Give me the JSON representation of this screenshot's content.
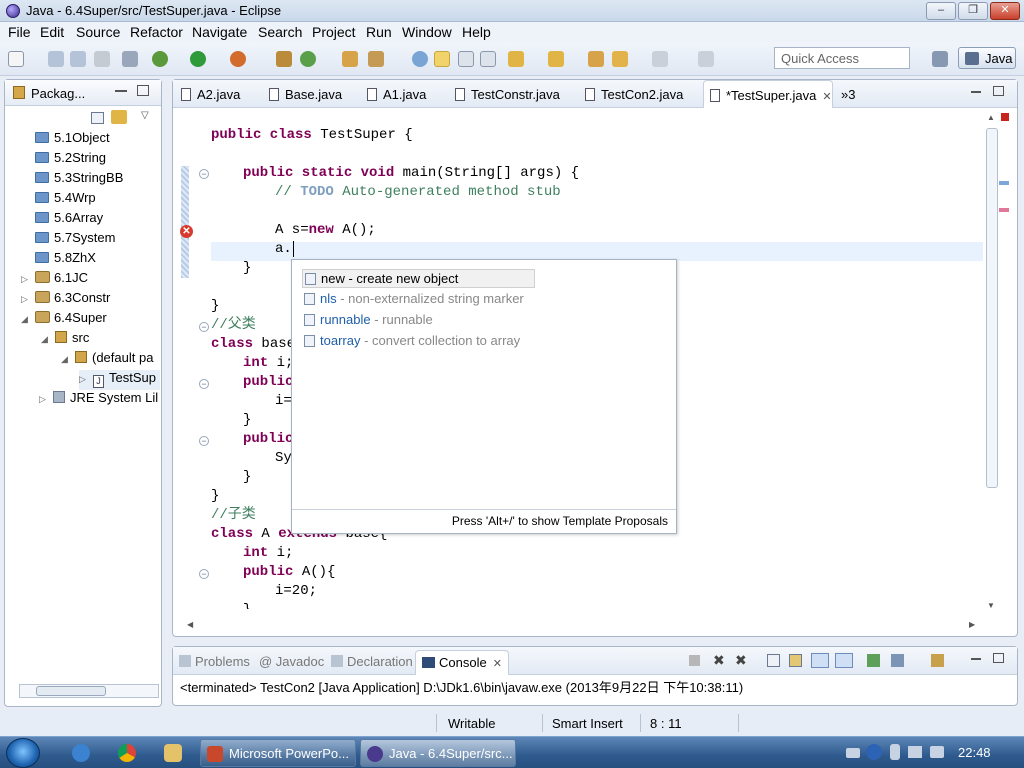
{
  "window": {
    "title": "Java - 6.4Super/src/TestSuper.java - Eclipse",
    "minimize": "–",
    "maximize": "❐",
    "close": "✕"
  },
  "menu": [
    "File",
    "Edit",
    "Source",
    "Refactor",
    "Navigate",
    "Search",
    "Project",
    "Run",
    "Window",
    "Help"
  ],
  "quick_access": {
    "placeholder": "Quick Access"
  },
  "perspective": {
    "label": "Java"
  },
  "package_explorer": {
    "title": "Packag...",
    "items": [
      {
        "label": "5.1Object",
        "kind": "folder"
      },
      {
        "label": "5.2String",
        "kind": "folder"
      },
      {
        "label": "5.3StringBB",
        "kind": "folder"
      },
      {
        "label": "5.4Wrp",
        "kind": "folder"
      },
      {
        "label": "5.6Array",
        "kind": "folder"
      },
      {
        "label": "5.7System",
        "kind": "folder"
      },
      {
        "label": "5.8ZhX",
        "kind": "folder"
      },
      {
        "label": "6.1JC",
        "kind": "project"
      },
      {
        "label": "6.3Constr",
        "kind": "project"
      },
      {
        "label": "6.4Super",
        "kind": "project"
      },
      {
        "label": "src",
        "kind": "srcfolder"
      },
      {
        "label": "(default pa",
        "kind": "package"
      },
      {
        "label": "TestSup",
        "kind": "javafile"
      },
      {
        "label": "JRE System Lil",
        "kind": "library"
      }
    ]
  },
  "editor": {
    "tabs": [
      "A2.java",
      "Base.java",
      "A1.java",
      "TestConstr.java",
      "TestCon2.java",
      "*TestSuper.java"
    ],
    "overflow_label": "»3",
    "tab_close": "✕",
    "code": {
      "l0": {
        "kw": "public class",
        "rest": " TestSuper {"
      },
      "l2": {
        "kw": "public static void",
        "rest": " main(String[] args) {"
      },
      "l3": {
        "pre": "// ",
        "todo": "TODO",
        "post": " Auto-generated method stub"
      },
      "l5": {
        "a": "A s=",
        "kw": "new",
        "b": " A();"
      },
      "l6": "a.",
      "l7": "}",
      "l9": "}",
      "l10": "//父类",
      "l11": {
        "kw": "class",
        "rest": " base"
      },
      "l12": {
        "kw": "int",
        "rest": " i;"
      },
      "l13": {
        "kw": "public"
      },
      "l14": "i=",
      "l15": "}",
      "l16": {
        "kw": "public"
      },
      "l17": "Sy",
      "l18": "}",
      "l19": "}",
      "l20": "//子类",
      "l21": {
        "kw1": "class",
        "mid": " A ",
        "kw2": "extends",
        "rest": " base{"
      },
      "l22": {
        "kw": "int",
        "rest": " i;"
      },
      "l23": {
        "kw": "public",
        "rest": " A(){"
      },
      "l24": "i=20;",
      "l25": "}"
    }
  },
  "content_assist": {
    "proposals": [
      {
        "name": "new",
        "desc": " - create new object"
      },
      {
        "name": "nls",
        "desc": " - non-externalized string marker"
      },
      {
        "name": "runnable",
        "desc": " - runnable"
      },
      {
        "name": "toarray",
        "desc": " - convert collection to array"
      }
    ],
    "footer": "Press 'Alt+/' to show Template Proposals"
  },
  "bottom_panel": {
    "tabs": [
      "Problems",
      "@ Javadoc",
      "Declaration",
      "Console"
    ],
    "console_text": "<terminated> TestCon2 [Java Application] D:\\JDk1.6\\bin\\javaw.exe (2013年9月22日 下午10:38:11)"
  },
  "status": {
    "writable": "Writable",
    "insert_mode": "Smart Insert",
    "position": "8 : 11"
  },
  "taskbar": {
    "apps": [
      "Microsoft PowerPo...",
      "Java - 6.4Super/src..."
    ],
    "clock": "22:48"
  }
}
